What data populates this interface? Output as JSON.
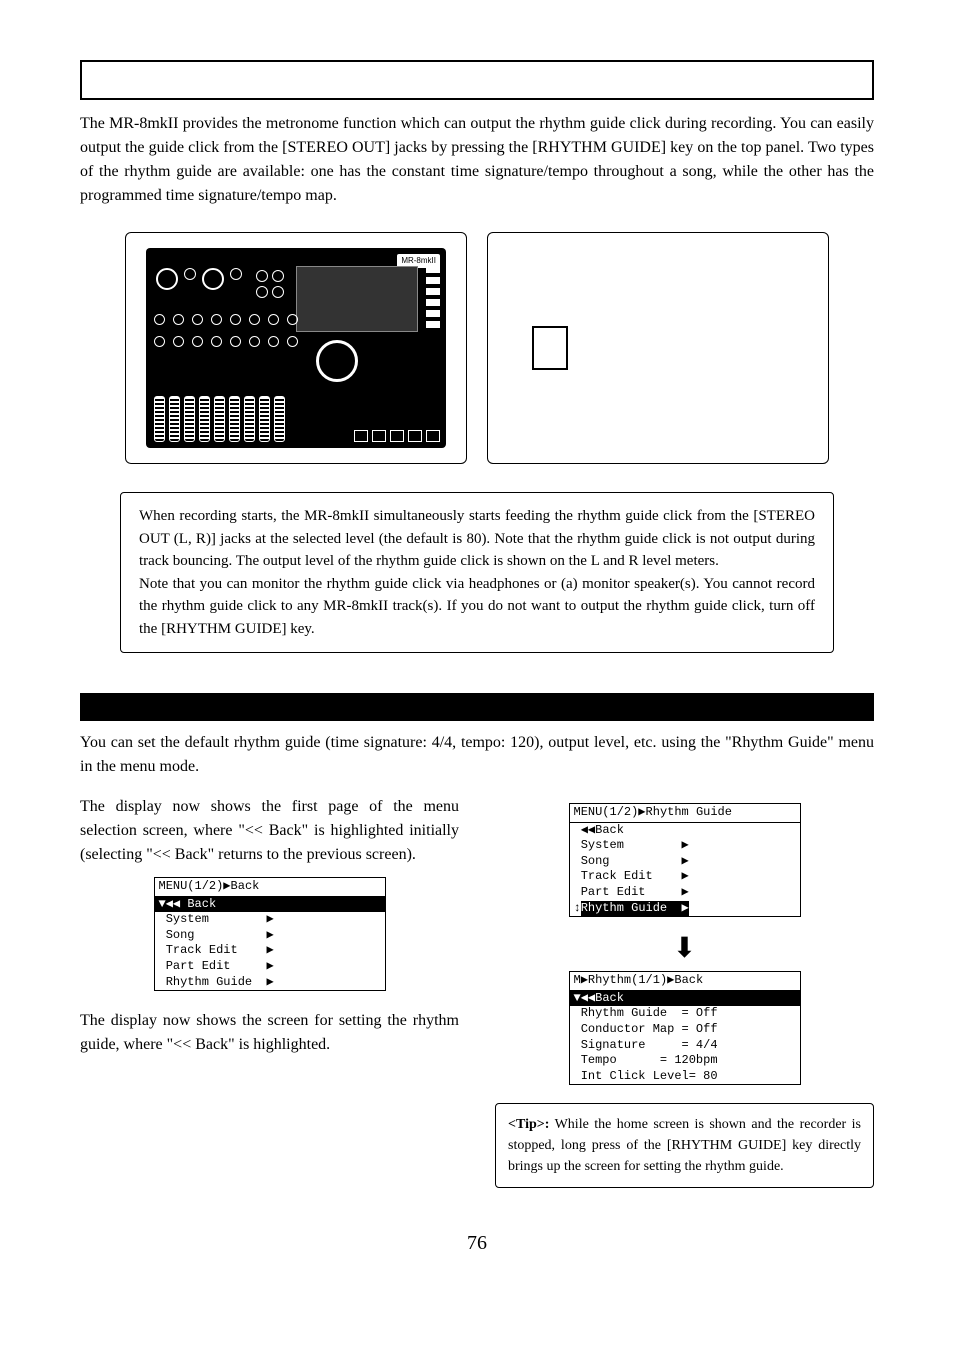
{
  "intro": "The MR-8mkII provides the metronome function which can output the rhythm guide click during recording. You can easily output the guide click from the [STEREO OUT] jacks by pressing the [RHYTHM GUIDE] key on the top panel. Two types of the rhythm guide are available: one has the constant time signature/tempo throughout a song, while the other has the programmed time signature/tempo map.",
  "device_tag": "MR-8mkII",
  "note_p1": "When recording starts, the MR-8mkII simultaneously starts feeding the rhythm guide click from the [STEREO OUT (L, R)] jacks at the selected level (the default is 80). Note that the rhythm guide click is not output during track bouncing. The output level of the rhythm guide click is shown on the L and R level meters.",
  "note_p2": "Note that you can monitor the rhythm guide click via headphones or (a) monitor speaker(s). You cannot record the rhythm guide click to any MR-8mkII track(s). If you do not want to output the rhythm guide click, turn off the [RHYTHM GUIDE] key.",
  "setting_intro": "You can set the default rhythm guide (time signature: 4/4, tempo: 120), output level, etc. using the \"Rhythm Guide\" menu in the menu mode.",
  "left_step": "The display now shows the first page of the menu selection screen, where \"<< Back\" is highlighted initially (selecting \"<< Back\" returns to the previous screen).",
  "left_step2": "The display now shows the screen for setting the rhythm guide, where \"<< Back\" is highlighted.",
  "tip_label": "<Tip>:",
  "tip_text": " While the home screen is shown and the recorder is stopped, long press of the [RHYTHM GUIDE] key directly brings up the screen for setting the rhythm guide.",
  "lcd1": {
    "title": "MENU(1/2)▶Back",
    "rows": [
      {
        "t": "▼◀◀ Back",
        "inv": true
      },
      {
        "t": " System        ▶",
        "inv": false
      },
      {
        "t": " Song          ▶",
        "inv": false
      },
      {
        "t": " Track Edit    ▶",
        "inv": false
      },
      {
        "t": " Part Edit     ▶",
        "inv": false
      },
      {
        "t": " Rhythm Guide  ▶",
        "inv": false
      }
    ]
  },
  "lcd2": {
    "title": "MENU(1/2)▶Rhythm Guide",
    "rows": [
      {
        "t": " ◀◀Back",
        "inv": false
      },
      {
        "t": " System        ▶",
        "inv": false
      },
      {
        "t": " Song          ▶",
        "inv": false
      },
      {
        "t": " Track Edit    ▶",
        "inv": false
      },
      {
        "t": " Part Edit     ▶",
        "inv": false
      },
      {
        "prefix": "↕",
        "t": "Rhythm Guide  ▶",
        "inv": true
      }
    ]
  },
  "lcd3": {
    "title": "M▶Rhythm(1/1)▶Back",
    "rows": [
      {
        "t": "▼◀◀Back",
        "inv": true
      },
      {
        "t": " Rhythm Guide  = Off",
        "inv": false
      },
      {
        "t": " Conductor Map = Off",
        "inv": false
      },
      {
        "t": " Signature     = 4/4",
        "inv": false
      },
      {
        "t": " Tempo      = 120bpm",
        "inv": false
      },
      {
        "t": " Int Click Level= 80",
        "inv": false
      }
    ]
  },
  "page_number": "76"
}
